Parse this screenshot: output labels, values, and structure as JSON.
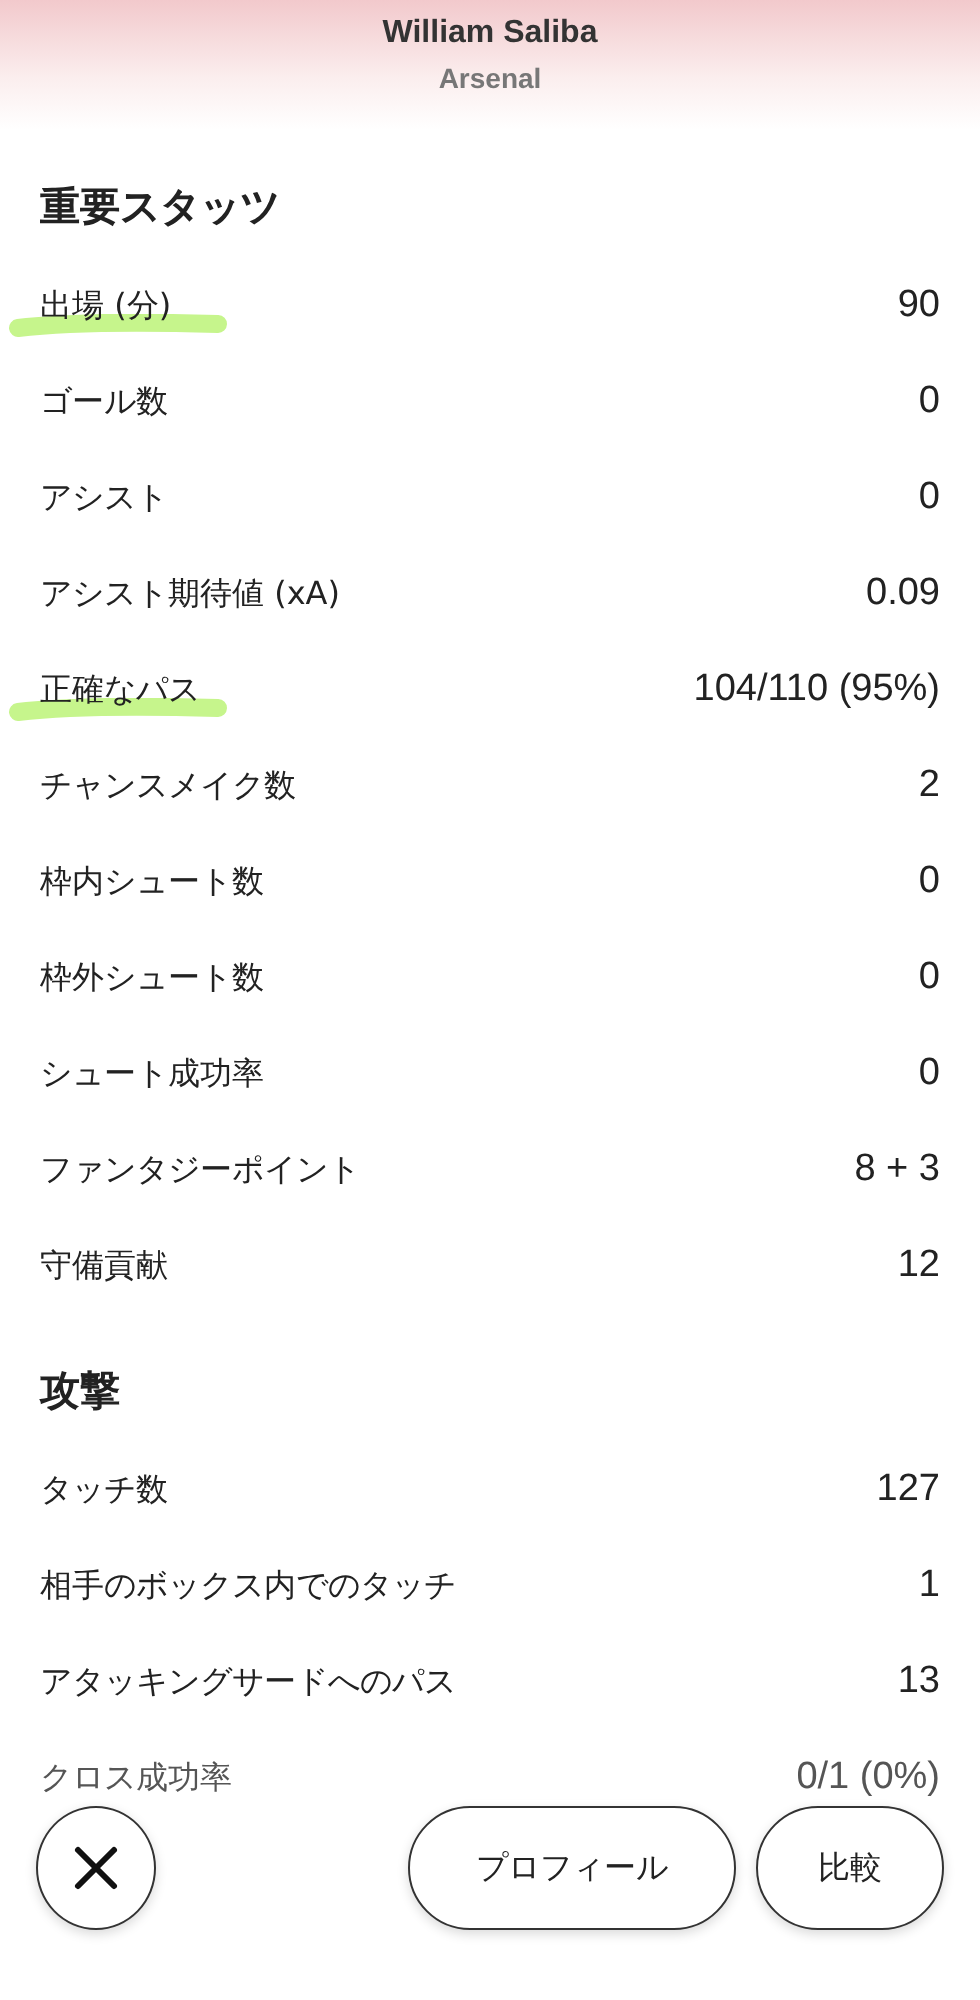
{
  "header": {
    "player": "William Saliba",
    "team": "Arsenal"
  },
  "sections": [
    {
      "title": "重要スタッツ",
      "rows": [
        {
          "label": "出場 (分)",
          "value": "90",
          "highlighted": true
        },
        {
          "label": "ゴール数",
          "value": "0",
          "highlighted": false
        },
        {
          "label": "アシスト",
          "value": "0",
          "highlighted": false
        },
        {
          "label": "アシスト期待値 (xA)",
          "value": "0.09",
          "highlighted": false
        },
        {
          "label": "正確なパス",
          "value": "104/110 (95%)",
          "highlighted": true
        },
        {
          "label": "チャンスメイク数",
          "value": "2",
          "highlighted": false
        },
        {
          "label": "枠内シュート数",
          "value": "0",
          "highlighted": false
        },
        {
          "label": "枠外シュート数",
          "value": "0",
          "highlighted": false
        },
        {
          "label": "シュート成功率",
          "value": "0",
          "highlighted": false
        },
        {
          "label": "ファンタジーポイント",
          "value": "8 + 3",
          "highlighted": false
        },
        {
          "label": "守備貢献",
          "value": "12",
          "highlighted": false
        }
      ]
    },
    {
      "title": "攻撃",
      "rows": [
        {
          "label": "タッチ数",
          "value": "127",
          "highlighted": false
        },
        {
          "label": "相手のボックス内でのタッチ",
          "value": "1",
          "highlighted": false
        },
        {
          "label": "アタッキングサードへのパス",
          "value": "13",
          "highlighted": false
        },
        {
          "label": "クロス成功率",
          "value": "0/1 (0%)",
          "highlighted": false
        }
      ]
    }
  ],
  "buttons": {
    "profile": "プロフィール",
    "compare": "比較"
  }
}
